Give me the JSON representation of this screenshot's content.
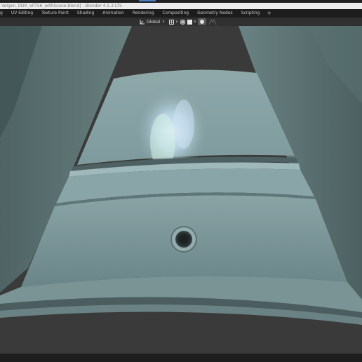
{
  "window": {
    "title": "Velgen_DDR_VFT56_withScene.blend] - Blender 4.5.3 LTS"
  },
  "workspace_tabs": [
    {
      "label": "g"
    },
    {
      "label": "UV Editing"
    },
    {
      "label": "Texture Paint"
    },
    {
      "label": "Shading"
    },
    {
      "label": "Animation"
    },
    {
      "label": "Rendering"
    },
    {
      "label": "Compositing"
    },
    {
      "label": "Geometry Nodes"
    },
    {
      "label": "Scripting"
    }
  ],
  "add_tab": "+",
  "viewport_header": {
    "transform_orientation": "Global",
    "dropdown_arrow": "∨"
  },
  "colors": {
    "tab_bar": "#1d1d1d",
    "header": "#303030",
    "viewport_background": "#3a3a3a",
    "wheel_surface": "#7f9a9c",
    "accent": "#4a7ec8"
  },
  "icons": [
    "transform-orientation-icon",
    "snap-icon",
    "proportional-edit-icon",
    "overlay-icon",
    "shading-solid-icon",
    "xray-icon"
  ]
}
